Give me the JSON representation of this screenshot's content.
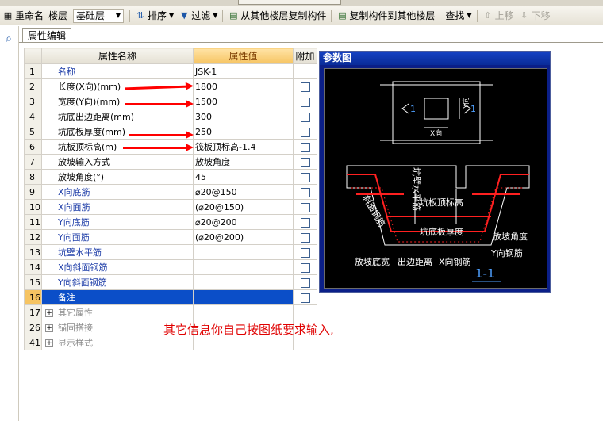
{
  "toolbar": {
    "rename": "重命名",
    "floor_label": "楼层",
    "floor_value": "基础层",
    "sort": "排序",
    "filter": "过滤",
    "copy_from": "从其他楼层复制构件",
    "copy_to": "复制构件到其他楼层",
    "find": "查找",
    "move_up": "上移",
    "move_down": "下移"
  },
  "tab": {
    "label": "属性编辑"
  },
  "grid": {
    "headers": {
      "name": "属性名称",
      "value": "属性值",
      "extra": "附加"
    },
    "rows": [
      {
        "num": "1",
        "name": "名称",
        "value": "JSK-1"
      },
      {
        "num": "2",
        "name": "长度(X向)(mm)",
        "value": "1800"
      },
      {
        "num": "3",
        "name": "宽度(Y向)(mm)",
        "value": "1500"
      },
      {
        "num": "4",
        "name": "坑底出边距离(mm)",
        "value": "300"
      },
      {
        "num": "5",
        "name": "坑底板厚度(mm)",
        "value": "250"
      },
      {
        "num": "6",
        "name": "坑板顶标高(m)",
        "value": "筏板顶标高-1.4"
      },
      {
        "num": "7",
        "name": "放坡输入方式",
        "value": "放坡角度"
      },
      {
        "num": "8",
        "name": "放坡角度(°)",
        "value": "45"
      },
      {
        "num": "9",
        "name": "X向底筋",
        "value": "⌀20@150"
      },
      {
        "num": "10",
        "name": "X向面筋",
        "value": "(⌀20@150)"
      },
      {
        "num": "11",
        "name": "Y向底筋",
        "value": "⌀20@200"
      },
      {
        "num": "12",
        "name": "Y向面筋",
        "value": "(⌀20@200)"
      },
      {
        "num": "13",
        "name": "坑壁水平筋",
        "value": ""
      },
      {
        "num": "14",
        "name": "X向斜面钢筋",
        "value": ""
      },
      {
        "num": "15",
        "name": "Y向斜面钢筋",
        "value": ""
      },
      {
        "num": "16",
        "name": "备注",
        "value": ""
      }
    ],
    "groups": [
      {
        "num": "17",
        "name": "其它属性"
      },
      {
        "num": "26",
        "name": "锚固搭接"
      },
      {
        "num": "41",
        "name": "显示样式"
      }
    ]
  },
  "param": {
    "title": "参数图",
    "label_1": "1",
    "label_xdir": "X向",
    "label_ydir": "Y向",
    "wall_rebar": "坑壁水平筋",
    "pit_top_elev": "坑板顶标高",
    "slope_rebar": "斜面钢筋",
    "pit_slab_thk": "坑底板厚度",
    "slope_angle": "放坡角度",
    "y_rebar": "Y向钢筋",
    "slope_width": "放坡底宽",
    "out_dist": "出边距离",
    "x_rebar": "X向钢筋",
    "section": "1-1"
  },
  "note": "其它信息你自己按图纸要求输入,",
  "colors": {
    "arrow": "#ff0000",
    "selected_row": "#0b4ec8",
    "value_header": "#f6c462"
  }
}
